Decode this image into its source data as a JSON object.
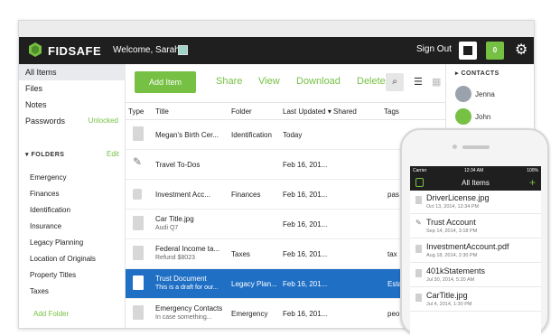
{
  "app": {
    "brand": "FIDSAFE",
    "welcome": "Welcome, Sarah",
    "sign_out": "Sign Out",
    "badge": "0"
  },
  "sidebar": {
    "items": [
      {
        "label": "All Items"
      },
      {
        "label": "Files"
      },
      {
        "label": "Notes"
      },
      {
        "label": "Passwords",
        "status": "Unlocked"
      }
    ],
    "folders_heading": "FOLDERS",
    "edit": "Edit",
    "folders": [
      "Emergency",
      "Finances",
      "Identification",
      "Insurance",
      "Legacy Planning",
      "Location of Originals",
      "Property Titles",
      "Taxes"
    ],
    "add_folder": "Add Folder"
  },
  "toolbar": {
    "add_item": "Add Item",
    "share": "Share",
    "view": "View",
    "download": "Download",
    "delete": "Delete"
  },
  "table": {
    "headers": [
      "Type",
      "Title",
      "Folder",
      "Last Updated",
      "Shared",
      "Tags"
    ],
    "rows": [
      {
        "title": "Megan's Birth Cer...",
        "subtitle": "",
        "folder": "Identification",
        "date": "Today",
        "tag": ""
      },
      {
        "title": "Travel To-Dos",
        "subtitle": "",
        "folder": "",
        "date": "Feb 16, 201...",
        "tag": ""
      },
      {
        "title": "Investment Acc...",
        "subtitle": "",
        "folder": "Finances",
        "date": "Feb 16, 201...",
        "tag": "pas"
      },
      {
        "title": "Car Title.jpg",
        "subtitle": "Audi Q7",
        "folder": "",
        "date": "Feb 16, 201...",
        "tag": ""
      },
      {
        "title": "Federal Income ta...",
        "subtitle": "Refund $8023",
        "folder": "Taxes",
        "date": "Feb 16, 201...",
        "tag": "tax"
      },
      {
        "title": "Trust Document",
        "subtitle": "This is a draft for our...",
        "folder": "Legacy Plan...",
        "date": "Feb 16, 201...",
        "tag": "Esta"
      },
      {
        "title": "Emergency Contacts",
        "subtitle": "In case something...",
        "folder": "Emergency",
        "date": "Feb 16, 201...",
        "tag": "peo"
      }
    ]
  },
  "contacts": {
    "heading": "CONTACTS",
    "people": [
      "Jenna",
      "John"
    ]
  },
  "mobile": {
    "status_carrier": "Carrier",
    "status_time": "12:34 AM",
    "status_battery": "100%",
    "nav_title": "All Items",
    "items": [
      {
        "title": "DriverLicense.jpg",
        "date": "Oct 13, 2014, 12:34 PM"
      },
      {
        "title": "Trust Account",
        "date": "Sep 14, 2014, 3:18 PM"
      },
      {
        "title": "InvestmentAccount.pdf",
        "date": "Aug 18, 2014, 2:30 PM"
      },
      {
        "title": "401kStatements",
        "date": "Jul 30, 2014, 5:20 AM"
      },
      {
        "title": "CarTitle.jpg",
        "date": "Jul 4, 2014, 1:30 PM"
      }
    ]
  }
}
